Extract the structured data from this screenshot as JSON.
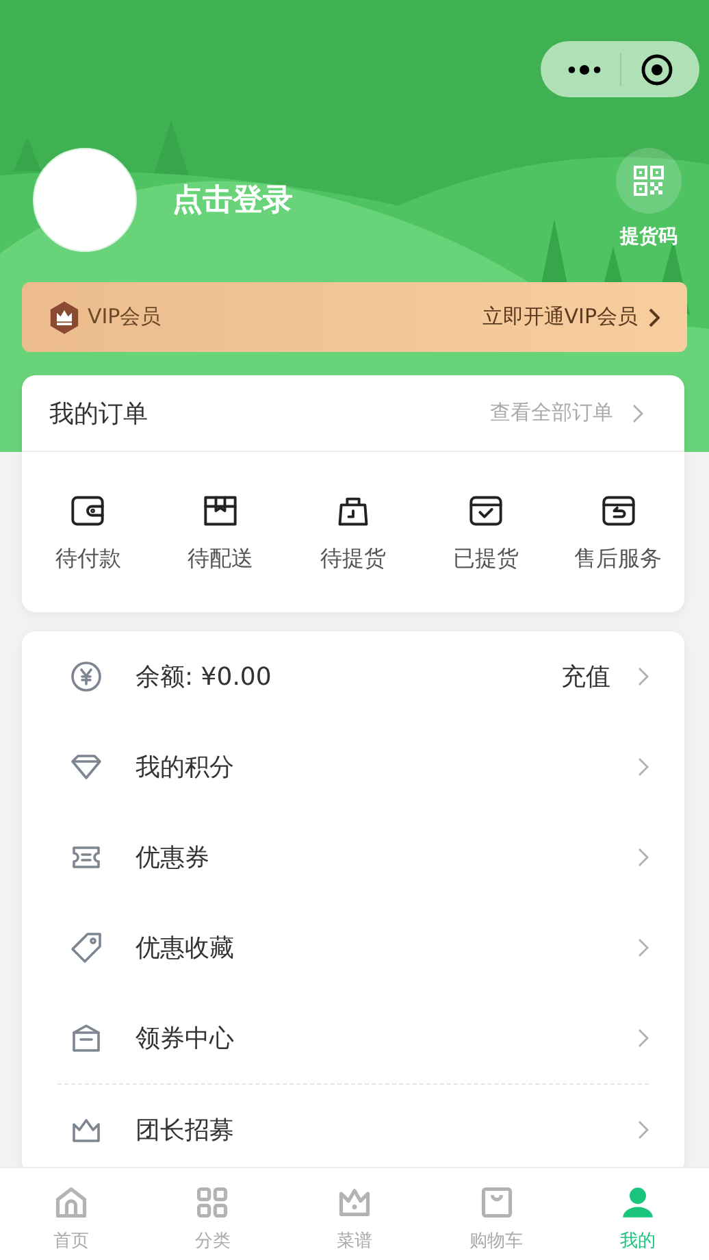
{
  "profile": {
    "login_text": "点击登录",
    "pickup_code": "提货码"
  },
  "vip": {
    "label": "VIP会员",
    "action": "立即开通VIP会员"
  },
  "orders": {
    "title": "我的订单",
    "view_all": "查看全部订单",
    "items": [
      {
        "kind": "wallet",
        "label": "待付款"
      },
      {
        "kind": "box",
        "label": "待配送"
      },
      {
        "kind": "bag",
        "label": "待提货"
      },
      {
        "kind": "check",
        "label": "已提货"
      },
      {
        "kind": "return",
        "label": "售后服务"
      }
    ]
  },
  "menu": [
    {
      "kind": "yen",
      "label": "余额: ¥0.00",
      "value": "充值",
      "divider": false
    },
    {
      "kind": "diamond",
      "label": "我的积分",
      "divider": false
    },
    {
      "kind": "ticket",
      "label": "优惠券",
      "divider": false
    },
    {
      "kind": "tag",
      "label": "优惠收藏",
      "divider": false
    },
    {
      "kind": "gift",
      "label": "领券中心",
      "divider": true
    },
    {
      "kind": "crown",
      "label": "团长招募",
      "divider": false
    }
  ],
  "tab_bar": [
    {
      "kind": "home",
      "label": "首页",
      "selected": false
    },
    {
      "kind": "grid",
      "label": "分类",
      "selected": false
    },
    {
      "kind": "crown",
      "label": "菜谱",
      "selected": false
    },
    {
      "kind": "bag",
      "label": "购物车",
      "selected": false
    },
    {
      "kind": "person",
      "label": "我的",
      "selected": true
    }
  ]
}
